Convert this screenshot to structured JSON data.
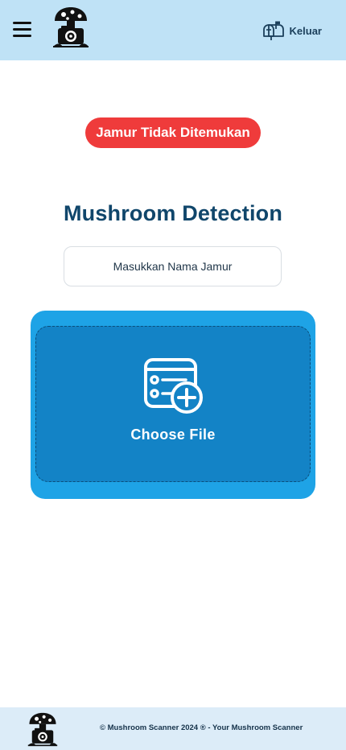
{
  "header": {
    "menu_icon": "hamburger-menu-icon",
    "logo_icon": "mushroom-camera-logo",
    "logout_icon": "mailbox-icon",
    "logout_label": "Keluar"
  },
  "alert": {
    "text": "Jamur Tidak Ditemukan",
    "color": "#ef3b3b"
  },
  "main": {
    "title": "Mushroom Detection",
    "name_input": {
      "placeholder": "Masukkan Nama Jamur",
      "value": ""
    },
    "upload": {
      "icon": "file-add-icon",
      "label": "Choose File"
    }
  },
  "footer": {
    "logo_icon": "mushroom-camera-logo",
    "copyright": "© Mushroom Scanner 2024 ® - Your Mushroom Scanner"
  },
  "colors": {
    "header_bg": "#bfe2f6",
    "accent": "#1ea3e6",
    "upload_inner": "#1383c6",
    "title": "#10466b",
    "footer_bg": "#dcecf8"
  }
}
